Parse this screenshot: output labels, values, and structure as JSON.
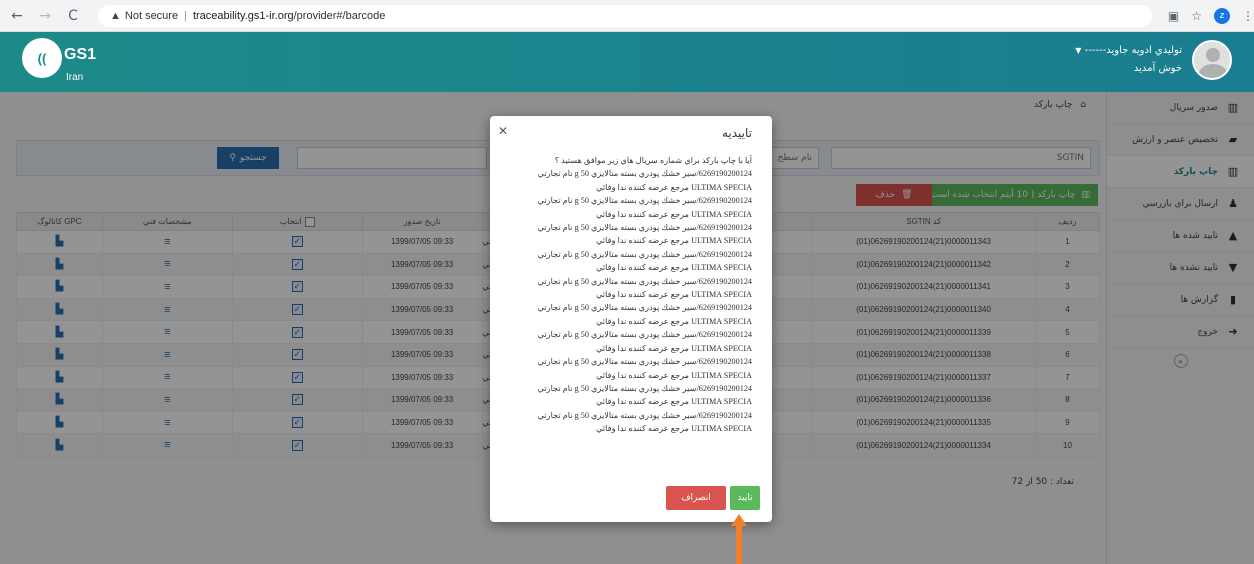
{
  "browser": {
    "security": "Not secure",
    "url_host": "traceability.gs1-ir.org",
    "url_path": "/provider#/barcode",
    "profile_letter": "z"
  },
  "header": {
    "logo": "GS1",
    "logo_sub": "Iran",
    "user_name": "------توليدي ادويه جاويد",
    "welcome": "خوش آمديد"
  },
  "sidebar": {
    "items": [
      {
        "label": "صدور سريال",
        "icon": "barcode-icon"
      },
      {
        "label": "تخصيص عنصر و ارزش",
        "icon": "folder-open-icon"
      },
      {
        "label": "چاپ بارکد",
        "icon": "barcode-icon",
        "active": true
      },
      {
        "label": "ارسال براي بازرسي",
        "icon": "users-icon"
      },
      {
        "label": "تاييد شده ها",
        "icon": "thumbs-up-icon"
      },
      {
        "label": "تاييد نشده ها",
        "icon": "thumbs-down-icon"
      },
      {
        "label": "گزارش ها",
        "icon": "bar-chart-icon"
      },
      {
        "label": "خروج",
        "icon": "sign-out-icon"
      }
    ]
  },
  "breadcrumb": "چاپ بارکد",
  "filter": {
    "sgtin_placeholder": "SGTIN",
    "level_placeholder": "نام سطح",
    "search_label": "جستجو"
  },
  "actions": {
    "print_label": "چاپ بارکد ( 10 آيتم انتخاب شده است )",
    "delete_label": "حذف"
  },
  "table": {
    "headers": [
      "رديف",
      "SGTIN کد",
      "",
      "تاريخ صدور",
      "انتخاب",
      "مشخصات فني",
      "کاتالوگ GPC"
    ],
    "rows": [
      {
        "idx": "1",
        "sgtin": "(01)06269190200124(21)0000011343",
        "name": "ا وفائي",
        "date": "1399/07/05 09:33"
      },
      {
        "idx": "2",
        "sgtin": "(01)06269190200124(21)0000011342",
        "name": "ا وفائي",
        "date": "1399/07/05 09:33"
      },
      {
        "idx": "3",
        "sgtin": "(01)06269190200124(21)0000011341",
        "name": "ا وفائي",
        "date": "1399/07/05 09:33"
      },
      {
        "idx": "4",
        "sgtin": "(01)06269190200124(21)0000011340",
        "name": "ا وفائي",
        "date": "1399/07/05 09:33"
      },
      {
        "idx": "5",
        "sgtin": "(01)06269190200124(21)0000011339",
        "name": "ا وفائي",
        "date": "1399/07/05 09:33"
      },
      {
        "idx": "6",
        "sgtin": "(01)06269190200124(21)0000011338",
        "name": "ا وفائي",
        "date": "1399/07/05 09:33"
      },
      {
        "idx": "7",
        "sgtin": "(01)06269190200124(21)0000011337",
        "name": "ا وفائي",
        "date": "1399/07/05 09:33"
      },
      {
        "idx": "8",
        "sgtin": "(01)06269190200124(21)0000011336",
        "name": "ا وفائي",
        "date": "1399/07/05 09:33"
      },
      {
        "idx": "9",
        "sgtin": "(01)06269190200124(21)0000011335",
        "name": "ا وفائي",
        "date": "1399/07/05 09:33"
      },
      {
        "idx": "10",
        "sgtin": "(01)06269190200124(21)0000011334",
        "name": "ا وفائي",
        "date": "1399/07/05 09:33"
      }
    ],
    "count": "تعداد : 50 از 72"
  },
  "modal": {
    "title": "تاييديه",
    "question": "آيا با چاپ بارکد براي شماره سريال هاي زير موافق هستيد ؟",
    "lines": [
      {
        "a": "6269190200124/سير خشك پودري بسته متالايزي 50 g نام تجارتي",
        "b": "ULTIMA SPECIA مرجع عرضه کننده ندا وفائي"
      },
      {
        "a": "6269190200124/سير خشك پودري بسته متالايزي 50 g نام تجارتي",
        "b": "ULTIMA SPECIA مرجع عرضه کننده ندا وفائي"
      },
      {
        "a": "6269190200124/سير خشك پودري بسته متالايزي 50 g نام تجارتي",
        "b": "ULTIMA SPECIA مرجع عرضه کننده ندا وفائي"
      },
      {
        "a": "6269190200124/سير خشك پودري بسته متالايزي 50 g نام تجارتي",
        "b": "ULTIMA SPECIA مرجع عرضه کننده ندا وفائي"
      },
      {
        "a": "6269190200124/سير خشك پودري بسته متالايزي 50 g نام تجارتي",
        "b": "ULTIMA SPECIA مرجع عرضه کننده ندا وفائي"
      },
      {
        "a": "6269190200124/سير خشك پودري بسته متالايزي 50 g نام تجارتي",
        "b": "ULTIMA SPECIA مرجع عرضه کننده ندا وفائي"
      },
      {
        "a": "6269190200124/سير خشك پودري بسته متالايزي 50 g نام تجارتي",
        "b": "ULTIMA SPECIA مرجع عرضه کننده ندا وفائي"
      },
      {
        "a": "6269190200124/سير خشك پودري بسته متالايزي 50 g نام تجارتي",
        "b": "ULTIMA SPECIA مرجع عرضه کننده ندا وفائي"
      },
      {
        "a": "6269190200124/سير خشك پودري بسته متالايزي 50 g نام تجارتي",
        "b": "ULTIMA SPECIA مرجع عرضه کننده ندا وفائي"
      },
      {
        "a": "6269190200124/سير خشك پودري بسته متالايزي 50 g نام تجارتي",
        "b": "ULTIMA SPECIA مرجع عرضه کننده ندا وفائي"
      }
    ],
    "confirm_label": "تاييد",
    "cancel_label": "انصراف"
  }
}
